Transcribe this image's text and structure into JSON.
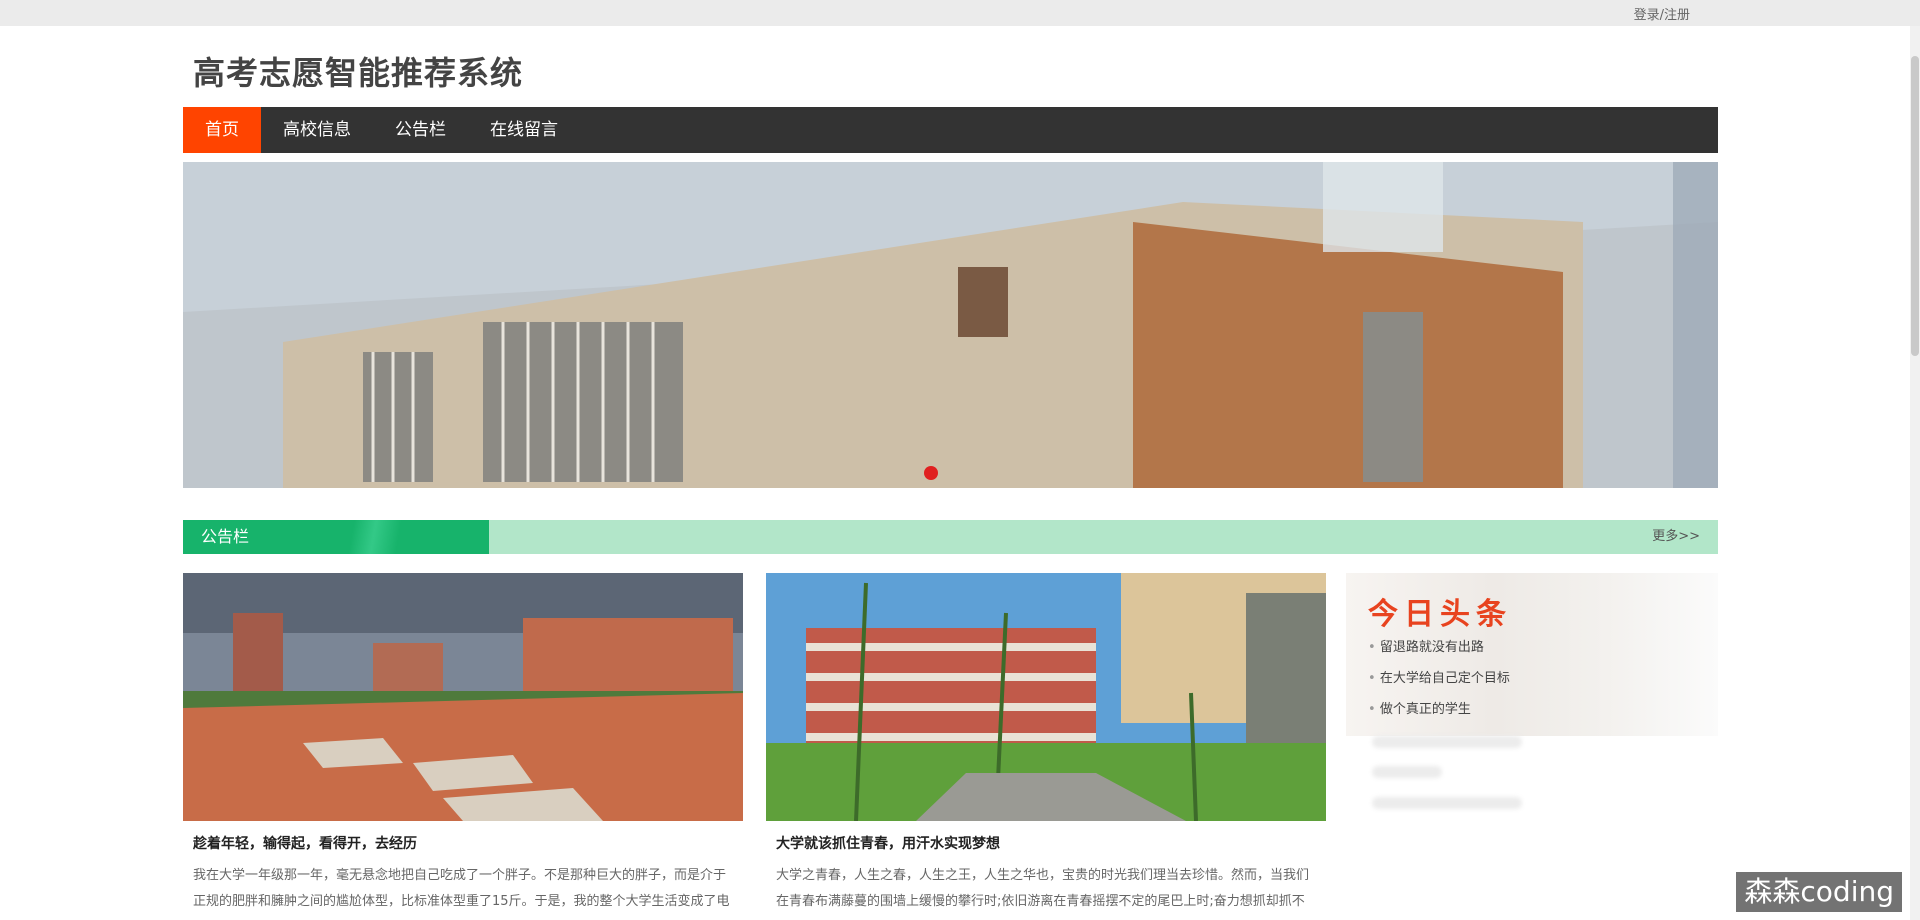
{
  "topbar": {
    "login_label": "登录/注册"
  },
  "site": {
    "title": "高考志愿智能推荐系统"
  },
  "nav": {
    "items": [
      {
        "label": "首页",
        "active": true
      },
      {
        "label": "高校信息",
        "active": false
      },
      {
        "label": "公告栏",
        "active": false
      },
      {
        "label": "在线留言",
        "active": false
      }
    ]
  },
  "banner": {
    "dot_color": "#e02020"
  },
  "notice": {
    "label": "公告栏",
    "more": "更多>>"
  },
  "cards": [
    {
      "title": "趁着年轻，输得起，看得开，去经历",
      "text": "我在大学一年级那一年，毫无悬念地把自己吃成了一个胖子。不是那种巨大的胖子，而是介于正规的肥胖和臃肿之间的尴尬体型，比标准体型重了15斤。于是，我的整个大学生活变成了电影"
    },
    {
      "title": "大学就该抓住青春，用汗水实现梦想",
      "text": "大学之青春，人生之春，人生之王，人生之华也，宝贵的时光我们理当去珍惜。然而，当我们在青春布满藤蔓的围墙上缓慢的攀行时;依旧游离在青春摇摆不定的尾巴上时;奋力想抓却抓不住，用"
    }
  ],
  "headlines": {
    "title": "今日头条",
    "items": [
      "留退路就没有出路",
      "在大学给自己定个目标",
      "做个真正的学生"
    ]
  },
  "watermark": "森森coding",
  "colors": {
    "nav_bg": "#333333",
    "nav_active": "#ff4400",
    "notice_label": "#17b36b",
    "notice_bar": "#b2e6c9"
  }
}
